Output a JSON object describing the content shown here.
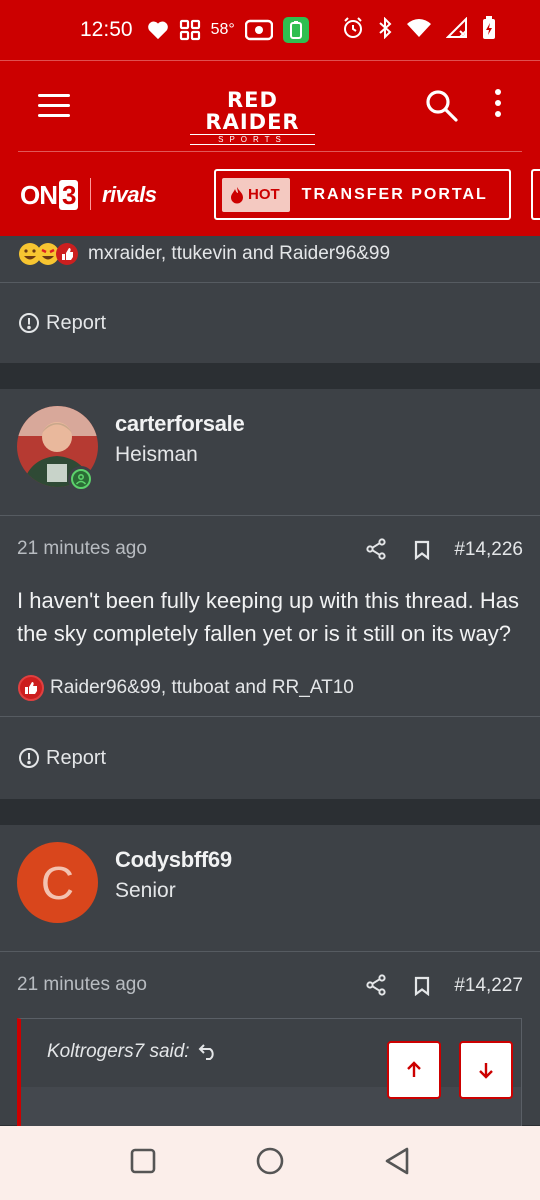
{
  "status": {
    "time": "12:50",
    "temperature": "58°"
  },
  "header": {
    "logo_main": "RED RAIDER",
    "logo_sub": "SPORTS"
  },
  "partner": {
    "on3_text": "ON",
    "on3_number": "3",
    "rivals": "rivals",
    "hot": "HOT",
    "transfer": "TRANSFER PORTAL"
  },
  "posts": [
    {
      "reactions": "mxraider, ttukevin and Raider96&99",
      "report": "Report"
    },
    {
      "username": "carterforsale",
      "title": "Heisman",
      "time": "21 minutes ago",
      "number": "#14,226",
      "body": "I haven't been fully keeping up with this thread. Has the sky completely fallen yet or is it still on its way?",
      "reactions": "Raider96&99, ttuboat and RR_AT10",
      "report": "Report"
    },
    {
      "username": "Codysbff69",
      "avatar_letter": "C",
      "title": "Senior",
      "time": "21 minutes ago",
      "number": "#14,227",
      "quote_author": "Koltrogers7 said:"
    }
  ],
  "colors": {
    "brand_red": "#cc0000",
    "card_bg": "#3d4146",
    "page_bg": "#2b2f33"
  }
}
